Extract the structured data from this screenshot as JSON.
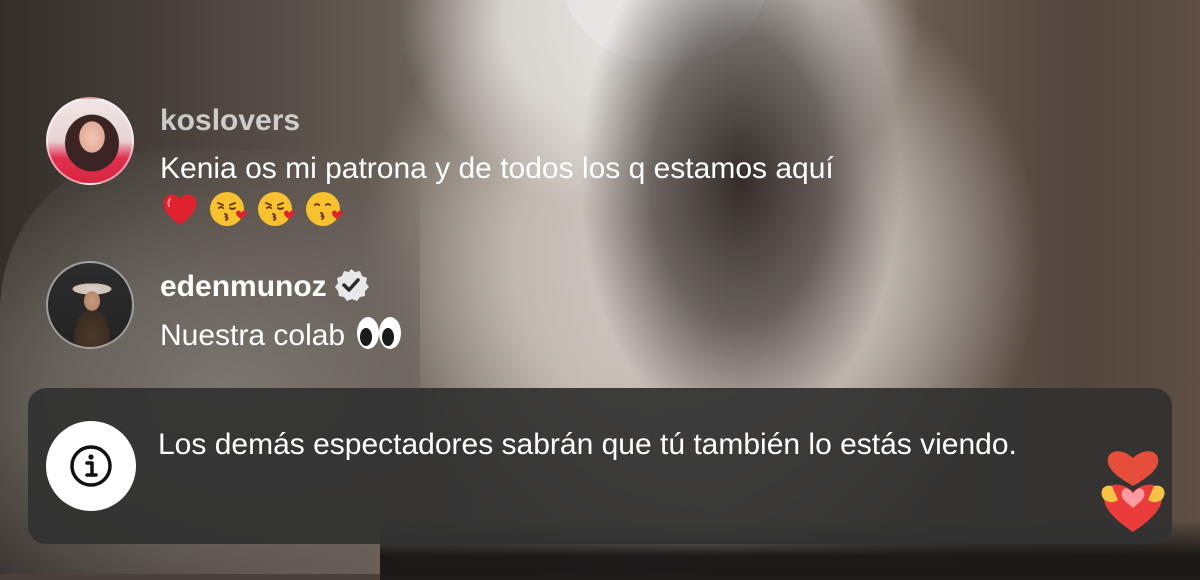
{
  "comments": [
    {
      "username": "koslovers",
      "verified": false,
      "message": "Kenia os mi patrona y de todos los q estamos aquí",
      "emojis": [
        "red-heart",
        "face-blowing-kiss",
        "face-blowing-kiss",
        "kissing-face-with-heart"
      ]
    },
    {
      "username": "edenmunoz",
      "verified": true,
      "message": "Nuestra colab",
      "emojis": [
        "eyes"
      ]
    }
  ],
  "notice": {
    "icon": "info-icon",
    "text": "Los demás espectadores sabrán que tú también lo estás viendo."
  },
  "reaction_button": {
    "icon": "heart-icon"
  }
}
